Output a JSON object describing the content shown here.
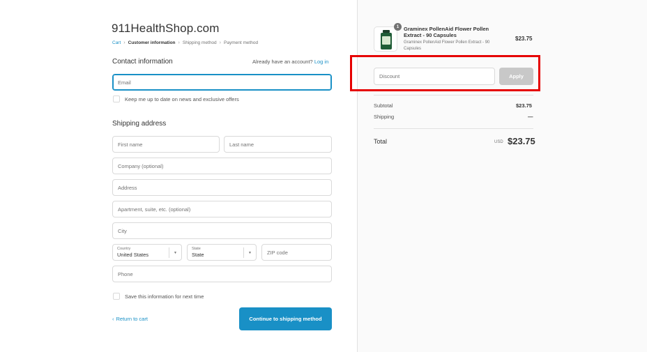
{
  "header": {
    "shop_title": "911HealthShop.com",
    "breadcrumb": [
      "Cart",
      "Customer information",
      "Shipping method",
      "Payment method"
    ]
  },
  "contact": {
    "title": "Contact information",
    "account_prompt": "Already have an account?",
    "login_label": "Log in",
    "email_placeholder": "Email",
    "newsletter_label": "Keep me up to date on news and exclusive offers"
  },
  "shipping": {
    "title": "Shipping address",
    "first_name": "First name",
    "last_name": "Last name",
    "company": "Company (optional)",
    "address": "Address",
    "apartment": "Apartment, suite, etc. (optional)",
    "city": "City",
    "country_label": "Country",
    "country_value": "United States",
    "state_label": "State",
    "state_value": "State",
    "zip": "ZIP code",
    "phone": "Phone",
    "save_info_label": "Save this information for next time"
  },
  "actions": {
    "return_label": "Return to cart",
    "return_chevron": "‹",
    "continue_label": "Continue to shipping method"
  },
  "order": {
    "product": {
      "quantity": "1",
      "name": "Graminex PollenAid Flower Pollen Extract - 90 Capsules",
      "variant": "Graminex PollenAid Flower Pollen Extract - 90 Capsules",
      "price": "$23.75"
    },
    "discount_placeholder": "Discount",
    "apply_label": "Apply",
    "subtotal_label": "Subtotal",
    "subtotal_value": "$23.75",
    "shipping_label": "Shipping",
    "shipping_value": "—",
    "total_label": "Total",
    "total_currency": "USD",
    "total_value": "$23.75"
  },
  "colors": {
    "accent": "#1990c6",
    "highlight": "#e60000",
    "button_disabled": "#c8c8c8"
  }
}
